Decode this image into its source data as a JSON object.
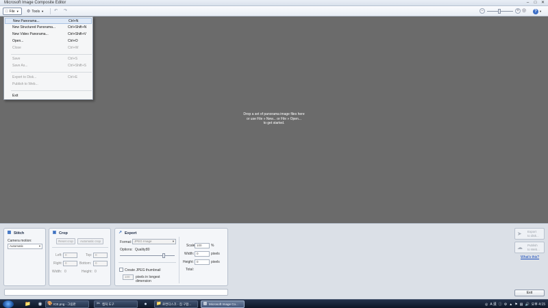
{
  "window": {
    "title": "Microsoft Image Composite Editor"
  },
  "toolbar": {
    "file_label": "File",
    "tools_label": "Tools"
  },
  "file_menu": {
    "items": [
      {
        "label": "New Panorama...",
        "shortcut": "Ctrl+N",
        "enabled": true,
        "highlighted": true
      },
      {
        "label": "New Structured Panorama...",
        "shortcut": "Ctrl+Shift+N",
        "enabled": true
      },
      {
        "label": "New Video Panorama...",
        "shortcut": "Ctrl+Shift+V",
        "enabled": true
      },
      {
        "label": "Open...",
        "shortcut": "Ctrl+O",
        "enabled": true
      },
      {
        "label": "Close",
        "shortcut": "Ctrl+W",
        "enabled": false
      },
      {
        "label": "Save",
        "shortcut": "Ctrl+S",
        "enabled": false
      },
      {
        "label": "Save As...",
        "shortcut": "Ctrl+Shift+S",
        "enabled": false
      },
      {
        "label": "Export to Disk...",
        "shortcut": "Ctrl+E",
        "enabled": false
      },
      {
        "label": "Publish to Web...",
        "shortcut": "",
        "enabled": false
      },
      {
        "label": "Exit",
        "shortcut": "",
        "enabled": true
      }
    ]
  },
  "canvas": {
    "drop_lines": [
      "Drop a set of panorama image files here",
      "or use File » New... or File » Open...",
      "to get started."
    ]
  },
  "stitch": {
    "title": "Stitch",
    "camera_motion_label": "Camera motion:",
    "camera_motion_value": "Automatic"
  },
  "crop": {
    "title": "Crop",
    "reset_label": "Reset crop",
    "auto_label": "Automatic crop",
    "left_label": "Left:",
    "left_value": "0",
    "top_label": "Top:",
    "top_value": "0",
    "right_label": "Right:",
    "right_value": "0",
    "bottom_label": "Bottom:",
    "bottom_value": "0",
    "width_label": "Width:",
    "width_value": "0",
    "height_label": "Height:",
    "height_value": "0"
  },
  "export": {
    "title": "Export",
    "format_label": "Format:",
    "format_value": "JPEG Image",
    "options_label": "Options:",
    "quality_label": "Quality:",
    "quality_value": "80",
    "quality_fraction": 0.8,
    "thumbnail_label": "Create JPEG thumbnail",
    "pixels_value": "100",
    "pixels_label_1": "pixels in longest",
    "pixels_label_2": "dimension",
    "scale_label": "Scale:",
    "scale_value": "100",
    "scale_unit": "%",
    "width_label": "Width:",
    "width_value": "0",
    "width_unit": "pixels",
    "height_label": "Height:",
    "height_value": "0",
    "height_unit": "pixels",
    "total_label": "Total:"
  },
  "side": {
    "export_disk_line1": "Export",
    "export_disk_line2": "to disk...",
    "publish_line1": "Publish",
    "publish_line2": "to Web...",
    "whats_this": "What's this?",
    "exit_label": "Exit"
  },
  "taskbar": {
    "tasks": [
      {
        "label": "ICE.png - 그림판",
        "icon": "paint-icon"
      },
      {
        "label": "캡처 도구",
        "icon": "snipping-icon"
      },
      {
        "label": "로컨디스크 - 집 구합...",
        "icon": "explorer-icon"
      },
      {
        "label": "Microsoft Image Co...",
        "icon": "ice-icon",
        "active": true
      }
    ],
    "ime": "A 漢",
    "clock": "오후 4:15"
  }
}
